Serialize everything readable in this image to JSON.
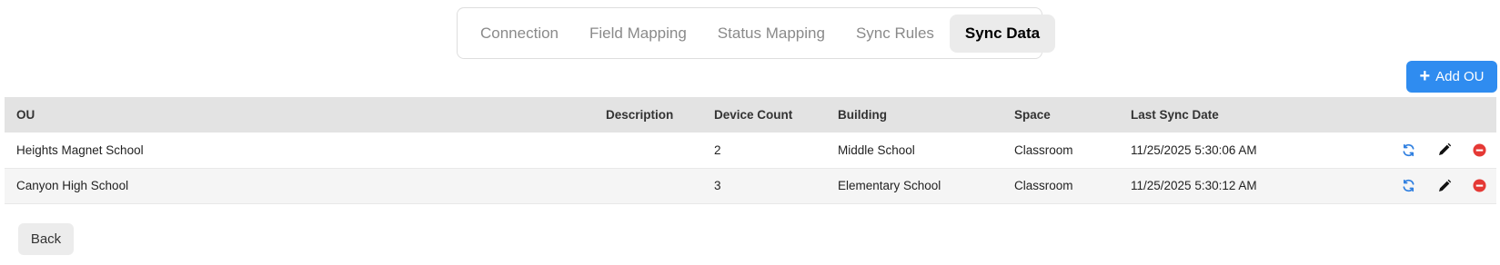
{
  "tabs": [
    {
      "label": "Connection",
      "active": false
    },
    {
      "label": "Field Mapping",
      "active": false
    },
    {
      "label": "Status Mapping",
      "active": false
    },
    {
      "label": "Sync Rules",
      "active": false
    },
    {
      "label": "Sync Data",
      "active": true
    }
  ],
  "toolbar": {
    "add_label": "Add OU",
    "add_icon": "plus-icon"
  },
  "table": {
    "columns": [
      "OU",
      "Description",
      "Device Count",
      "Building",
      "Space",
      "Last Sync Date"
    ],
    "rows": [
      {
        "ou": "Heights Magnet School",
        "description": "",
        "device_count": "2",
        "building": "Middle School",
        "space": "Classroom",
        "last_sync": "11/25/2025 5:30:06 AM"
      },
      {
        "ou": "Canyon High School",
        "description": "",
        "device_count": "3",
        "building": "Elementary School",
        "space": "Classroom",
        "last_sync": "11/25/2025 5:30:12 AM"
      }
    ],
    "row_actions": [
      "sync-icon",
      "edit-pencil-icon",
      "remove-icon"
    ]
  },
  "footer": {
    "back_label": "Back"
  },
  "colors": {
    "accent": "#2f8cf0",
    "danger": "#e53935",
    "sync_icon": "#2f7fe0",
    "header_bg": "#e3e3e3"
  }
}
